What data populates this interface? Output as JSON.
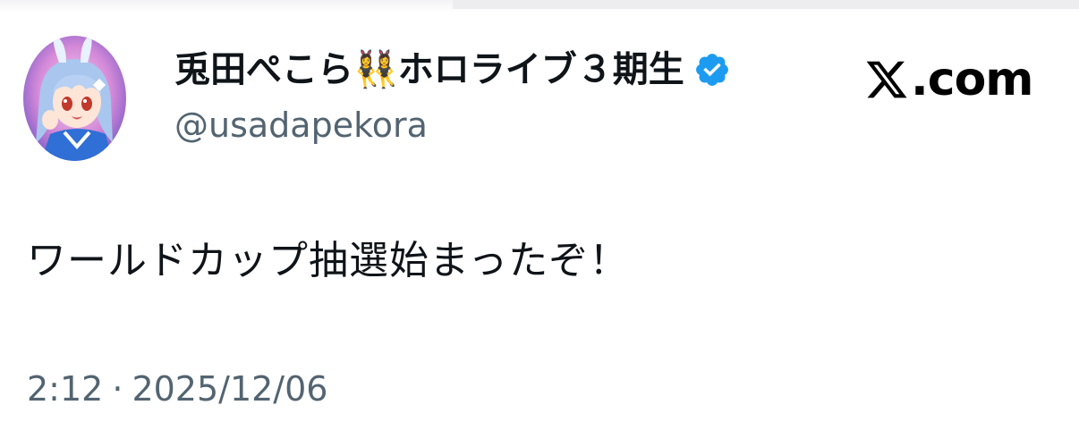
{
  "tweet": {
    "author": {
      "display_name": "兎田ぺこら👯‍♀️ホロライブ３期生",
      "handle": "@usadapekora",
      "verified": true,
      "avatar_icon": "avatar-image"
    },
    "brand": {
      "label": ".com",
      "logo_icon": "x-logo-icon"
    },
    "text": "ワールドカップ抽選始まったぞ！",
    "time": "2:12",
    "separator": "·",
    "date": "2025/12/06"
  },
  "colors": {
    "text_primary": "#0f1419",
    "text_secondary": "#536471",
    "verified_blue": "#1d9bf0",
    "background": "#ffffff"
  }
}
